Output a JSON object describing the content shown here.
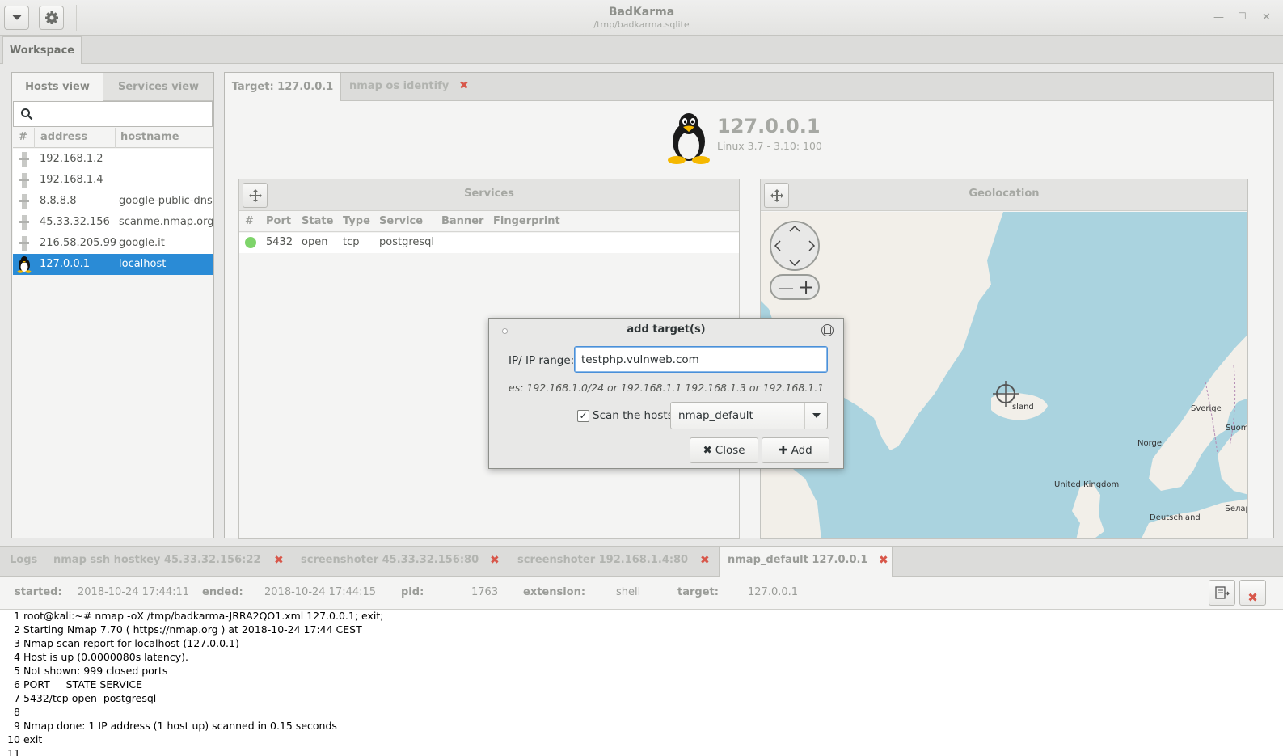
{
  "window": {
    "title": "BadKarma",
    "subtitle": "/tmp/badkarma.sqlite",
    "workspace_tab": "Workspace"
  },
  "hosts_panel": {
    "tabs": [
      "Hosts view",
      "Services view"
    ],
    "search_placeholder": "",
    "columns": [
      "#",
      "address",
      "hostname"
    ],
    "rows": [
      {
        "address": "192.168.1.2",
        "hostname": "",
        "icon": "generic-host-icon"
      },
      {
        "address": "192.168.1.4",
        "hostname": "",
        "icon": "generic-host-icon"
      },
      {
        "address": "8.8.8.8",
        "hostname": "google-public-dns",
        "icon": "generic-host-icon"
      },
      {
        "address": "45.33.32.156",
        "hostname": "scanme.nmap.org",
        "icon": "generic-host-icon"
      },
      {
        "address": "216.58.205.99",
        "hostname": "google.it",
        "icon": "generic-host-icon"
      },
      {
        "address": "127.0.0.1",
        "hostname": "localhost",
        "icon": "linux-tux-icon",
        "selected": true
      }
    ]
  },
  "target_panel": {
    "tabs": [
      "Target: 127.0.0.1",
      "nmap os identify"
    ],
    "host_ip": "127.0.0.1",
    "host_os": "Linux 3.7 - 3.10: 100",
    "services": {
      "title": "Services",
      "columns": [
        "#",
        "Port",
        "State",
        "Type",
        "Service",
        "Banner",
        "Fingerprint"
      ],
      "rows": [
        {
          "port": "5432",
          "state": "open",
          "type": "tcp",
          "service": "postgresql",
          "banner": "",
          "fingerprint": ""
        }
      ]
    },
    "geolocation": {
      "title": "Geolocation",
      "labels": [
        "Ísland",
        "Sverige",
        "Suomi",
        "Norge",
        "United Kingdom",
        "Deutschland",
        "Белар"
      ]
    }
  },
  "dialog": {
    "title": "add target(s)",
    "ip_label": "IP/ IP range:",
    "ip_value": "testphp.vulnweb.com",
    "hint": "es: 192.168.1.0/24 or 192.168.1.1 192.168.1.3 or 192.168.1.1",
    "scan_checked": true,
    "scan_label": "Scan the hosts",
    "scan_profile": "nmap_default",
    "close_label": "Close",
    "add_label": "Add"
  },
  "bottom_tabs": [
    {
      "label": "Logs",
      "closable": false
    },
    {
      "label": "nmap ssh hostkey 45.33.32.156:22",
      "closable": true
    },
    {
      "label": "screenshoter 45.33.32.156:80",
      "closable": true
    },
    {
      "label": "screenshoter 192.168.1.4:80",
      "closable": true
    },
    {
      "label": "nmap_default 127.0.0.1",
      "closable": true,
      "active": true
    }
  ],
  "task_info": {
    "started_label": "started:",
    "started": "2018-10-24 17:44:11",
    "ended_label": "ended:",
    "ended": "2018-10-24 17:44:15",
    "pid_label": "pid:",
    "pid": "1763",
    "extension_label": "extension:",
    "extension": "shell",
    "target_label": "target:",
    "target": "127.0.0.1"
  },
  "console": {
    "lines": [
      {
        "n": "1",
        "text": "root@kali:~# nmap -oX /tmp/badkarma-JRRA2QO1.xml 127.0.0.1; exit;"
      },
      {
        "n": "2",
        "text": "Starting Nmap 7.70 ( https://nmap.org ) at 2018-10-24 17:44 CEST"
      },
      {
        "n": "3",
        "text": "Nmap scan report for localhost (127.0.0.1)"
      },
      {
        "n": "4",
        "text": "Host is up (0.0000080s latency)."
      },
      {
        "n": "5",
        "text": "Not shown: 999 closed ports"
      },
      {
        "n": "6",
        "text": "PORT     STATE SERVICE"
      },
      {
        "n": "7",
        "text": "5432/tcp open  postgresql"
      },
      {
        "n": "8",
        "text": ""
      },
      {
        "n": "9",
        "text": "Nmap done: 1 IP address (1 host up) scanned in 0.15 seconds"
      },
      {
        "n": "10",
        "text": "exit"
      },
      {
        "n": "11",
        "text": ""
      }
    ]
  }
}
